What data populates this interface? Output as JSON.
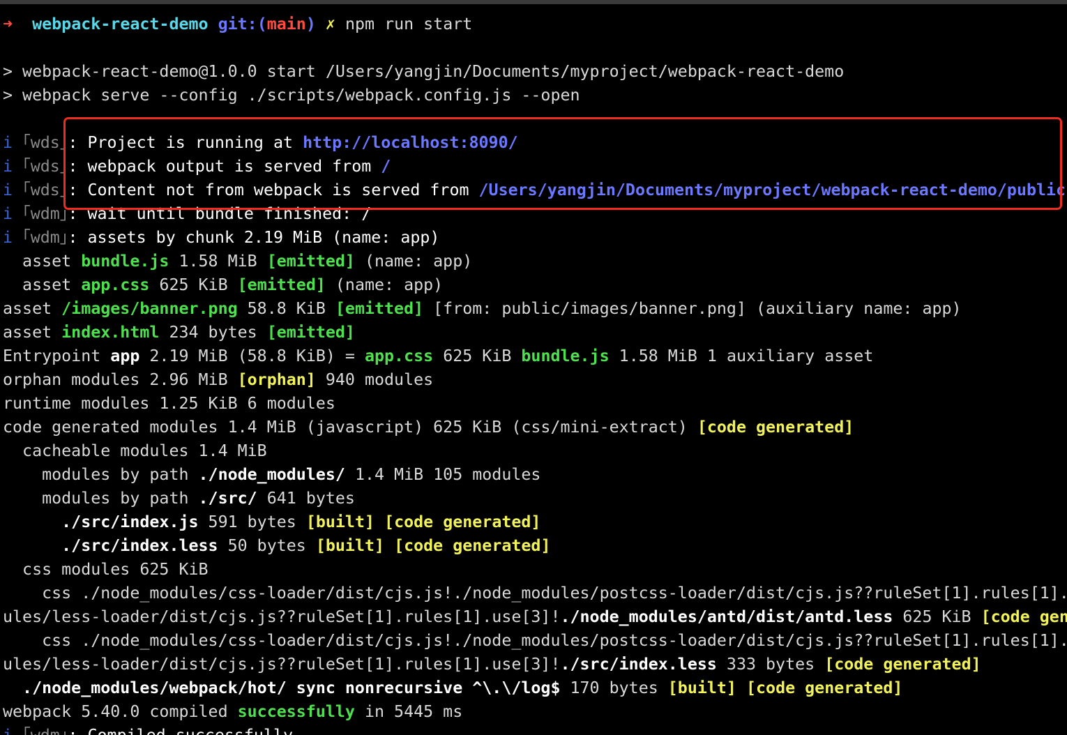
{
  "colors": {
    "background": "#000000",
    "default_text": "#d9d9d9",
    "green": "#4fe04f",
    "yellow": "#f2f25a",
    "cyan": "#58d8e8",
    "blue": "#6c78ff",
    "red": "#ff4a40",
    "highlight_box": "#ee2c1f"
  },
  "prompt": {
    "arrow": "➜",
    "directory": "webpack-react-demo",
    "git_label": "git:(",
    "branch": "main",
    "git_close": ")",
    "dirty_mark": "✗",
    "command": "npm run start"
  },
  "lines": [
    [
      {
        "t": "> webpack-react-demo@1.0.0 start /Users/yangjin/Documents/myproject/webpack-react-demo",
        "c": "default"
      }
    ],
    [
      {
        "t": "> webpack serve --config ./scripts/webpack.config.js --open",
        "c": "default"
      }
    ],
    [],
    [
      {
        "t": "i ",
        "c": "info"
      },
      {
        "t": "｢wds｣",
        "c": "gray"
      },
      {
        "t": ": Project is running at ",
        "c": "white"
      },
      {
        "t": "http://localhost:8090/",
        "c": "blue",
        "b": true
      }
    ],
    [
      {
        "t": "i ",
        "c": "info"
      },
      {
        "t": "｢wds｣",
        "c": "gray"
      },
      {
        "t": ": webpack output is served from ",
        "c": "white"
      },
      {
        "t": "/",
        "c": "blue",
        "b": true
      }
    ],
    [
      {
        "t": "i ",
        "c": "info"
      },
      {
        "t": "｢wds｣",
        "c": "gray"
      },
      {
        "t": ": Content not from webpack is served from ",
        "c": "white"
      },
      {
        "t": "/Users/yangjin/Documents/myproject/webpack-react-demo/public",
        "c": "blue",
        "b": true
      }
    ],
    [
      {
        "t": "i ",
        "c": "info"
      },
      {
        "t": "｢wdm｣",
        "c": "gray"
      },
      {
        "t": ": wait until bundle finished: /",
        "c": "white"
      }
    ],
    [
      {
        "t": "i ",
        "c": "info"
      },
      {
        "t": "｢wdm｣",
        "c": "gray"
      },
      {
        "t": ": assets by chunk 2.19 MiB (name: app)",
        "c": "white"
      }
    ],
    [
      {
        "t": "  asset ",
        "c": "default"
      },
      {
        "t": "bundle.js",
        "c": "green",
        "b": true
      },
      {
        "t": " 1.58 MiB ",
        "c": "default"
      },
      {
        "t": "[emitted]",
        "c": "green",
        "b": true
      },
      {
        "t": " (name: app)",
        "c": "default"
      }
    ],
    [
      {
        "t": "  asset ",
        "c": "default"
      },
      {
        "t": "app.css",
        "c": "green",
        "b": true
      },
      {
        "t": " 625 KiB ",
        "c": "default"
      },
      {
        "t": "[emitted]",
        "c": "green",
        "b": true
      },
      {
        "t": " (name: app)",
        "c": "default"
      }
    ],
    [
      {
        "t": "asset ",
        "c": "default"
      },
      {
        "t": "/images/banner.png",
        "c": "green",
        "b": true
      },
      {
        "t": " 58.8 KiB ",
        "c": "default"
      },
      {
        "t": "[emitted]",
        "c": "green",
        "b": true
      },
      {
        "t": " [from: public/images/banner.png] (auxiliary name: app)",
        "c": "default"
      }
    ],
    [
      {
        "t": "asset ",
        "c": "default"
      },
      {
        "t": "index.html",
        "c": "green",
        "b": true
      },
      {
        "t": " 234 bytes ",
        "c": "default"
      },
      {
        "t": "[emitted]",
        "c": "green",
        "b": true
      }
    ],
    [
      {
        "t": "Entrypoint ",
        "c": "default"
      },
      {
        "t": "app",
        "c": "white",
        "b": true
      },
      {
        "t": " 2.19 MiB (58.8 KiB) = ",
        "c": "default"
      },
      {
        "t": "app.css",
        "c": "green",
        "b": true
      },
      {
        "t": " 625 KiB ",
        "c": "default"
      },
      {
        "t": "bundle.js",
        "c": "green",
        "b": true
      },
      {
        "t": " 1.58 MiB 1 auxiliary asset",
        "c": "default"
      }
    ],
    [
      {
        "t": "orphan modules 2.96 MiB ",
        "c": "default"
      },
      {
        "t": "[orphan]",
        "c": "yellow",
        "b": true
      },
      {
        "t": " 940 modules",
        "c": "default"
      }
    ],
    [
      {
        "t": "runtime modules 1.25 KiB 6 modules",
        "c": "default"
      }
    ],
    [
      {
        "t": "code generated modules 1.4 MiB (javascript) 625 KiB (css/mini-extract) ",
        "c": "default"
      },
      {
        "t": "[code generated]",
        "c": "yellow",
        "b": true
      }
    ],
    [
      {
        "t": "  cacheable modules 1.4 MiB",
        "c": "default"
      }
    ],
    [
      {
        "t": "    modules by path ",
        "c": "default"
      },
      {
        "t": "./node_modules/",
        "c": "white",
        "b": true
      },
      {
        "t": " 1.4 MiB 105 modules",
        "c": "default"
      }
    ],
    [
      {
        "t": "    modules by path ",
        "c": "default"
      },
      {
        "t": "./src/",
        "c": "white",
        "b": true
      },
      {
        "t": " 641 bytes",
        "c": "default"
      }
    ],
    [
      {
        "t": "      ./src/index.js",
        "c": "white",
        "b": true
      },
      {
        "t": " 591 bytes ",
        "c": "default"
      },
      {
        "t": "[built]",
        "c": "yellow",
        "b": true
      },
      {
        "t": " ",
        "c": "default"
      },
      {
        "t": "[code generated]",
        "c": "yellow",
        "b": true
      }
    ],
    [
      {
        "t": "      ./src/index.less",
        "c": "white",
        "b": true
      },
      {
        "t": " 50 bytes ",
        "c": "default"
      },
      {
        "t": "[built]",
        "c": "yellow",
        "b": true
      },
      {
        "t": " ",
        "c": "default"
      },
      {
        "t": "[code generated]",
        "c": "yellow",
        "b": true
      }
    ],
    [
      {
        "t": "  css modules 625 KiB",
        "c": "default"
      }
    ],
    [
      {
        "t": "    css ./node_modules/css-loader/dist/cjs.js!./node_modules/postcss-loader/dist/cjs.js??ruleSet[1].rules[1].",
        "c": "default"
      }
    ],
    [
      {
        "t": "ules/less-loader/dist/cjs.js??ruleSet[1].rules[1].use[3]!",
        "c": "default"
      },
      {
        "t": "./node_modules/antd/dist/antd.less",
        "c": "white",
        "b": true
      },
      {
        "t": " 625 KiB ",
        "c": "default"
      },
      {
        "t": "[code gen",
        "c": "yellow",
        "b": true
      }
    ],
    [
      {
        "t": "    css ./node_modules/css-loader/dist/cjs.js!./node_modules/postcss-loader/dist/cjs.js??ruleSet[1].rules[1].",
        "c": "default"
      }
    ],
    [
      {
        "t": "ules/less-loader/dist/cjs.js??ruleSet[1].rules[1].use[3]!",
        "c": "default"
      },
      {
        "t": "./src/index.less",
        "c": "white",
        "b": true
      },
      {
        "t": " 333 bytes ",
        "c": "default"
      },
      {
        "t": "[code generated]",
        "c": "yellow",
        "b": true
      }
    ],
    [
      {
        "t": "  ./node_modules/webpack/hot/ sync nonrecursive ^\\.\\/log$",
        "c": "white",
        "b": true
      },
      {
        "t": " 170 bytes ",
        "c": "default"
      },
      {
        "t": "[built]",
        "c": "yellow",
        "b": true
      },
      {
        "t": " ",
        "c": "default"
      },
      {
        "t": "[code generated]",
        "c": "yellow",
        "b": true
      }
    ],
    [
      {
        "t": "webpack 5.40.0 compiled ",
        "c": "default"
      },
      {
        "t": "successfully",
        "c": "green",
        "b": true
      },
      {
        "t": " in 5445 ms",
        "c": "default"
      }
    ],
    [
      {
        "t": "i ",
        "c": "info"
      },
      {
        "t": "｢wdm｣",
        "c": "gray"
      },
      {
        "t": ": Compiled successfully.",
        "c": "white"
      }
    ]
  ]
}
